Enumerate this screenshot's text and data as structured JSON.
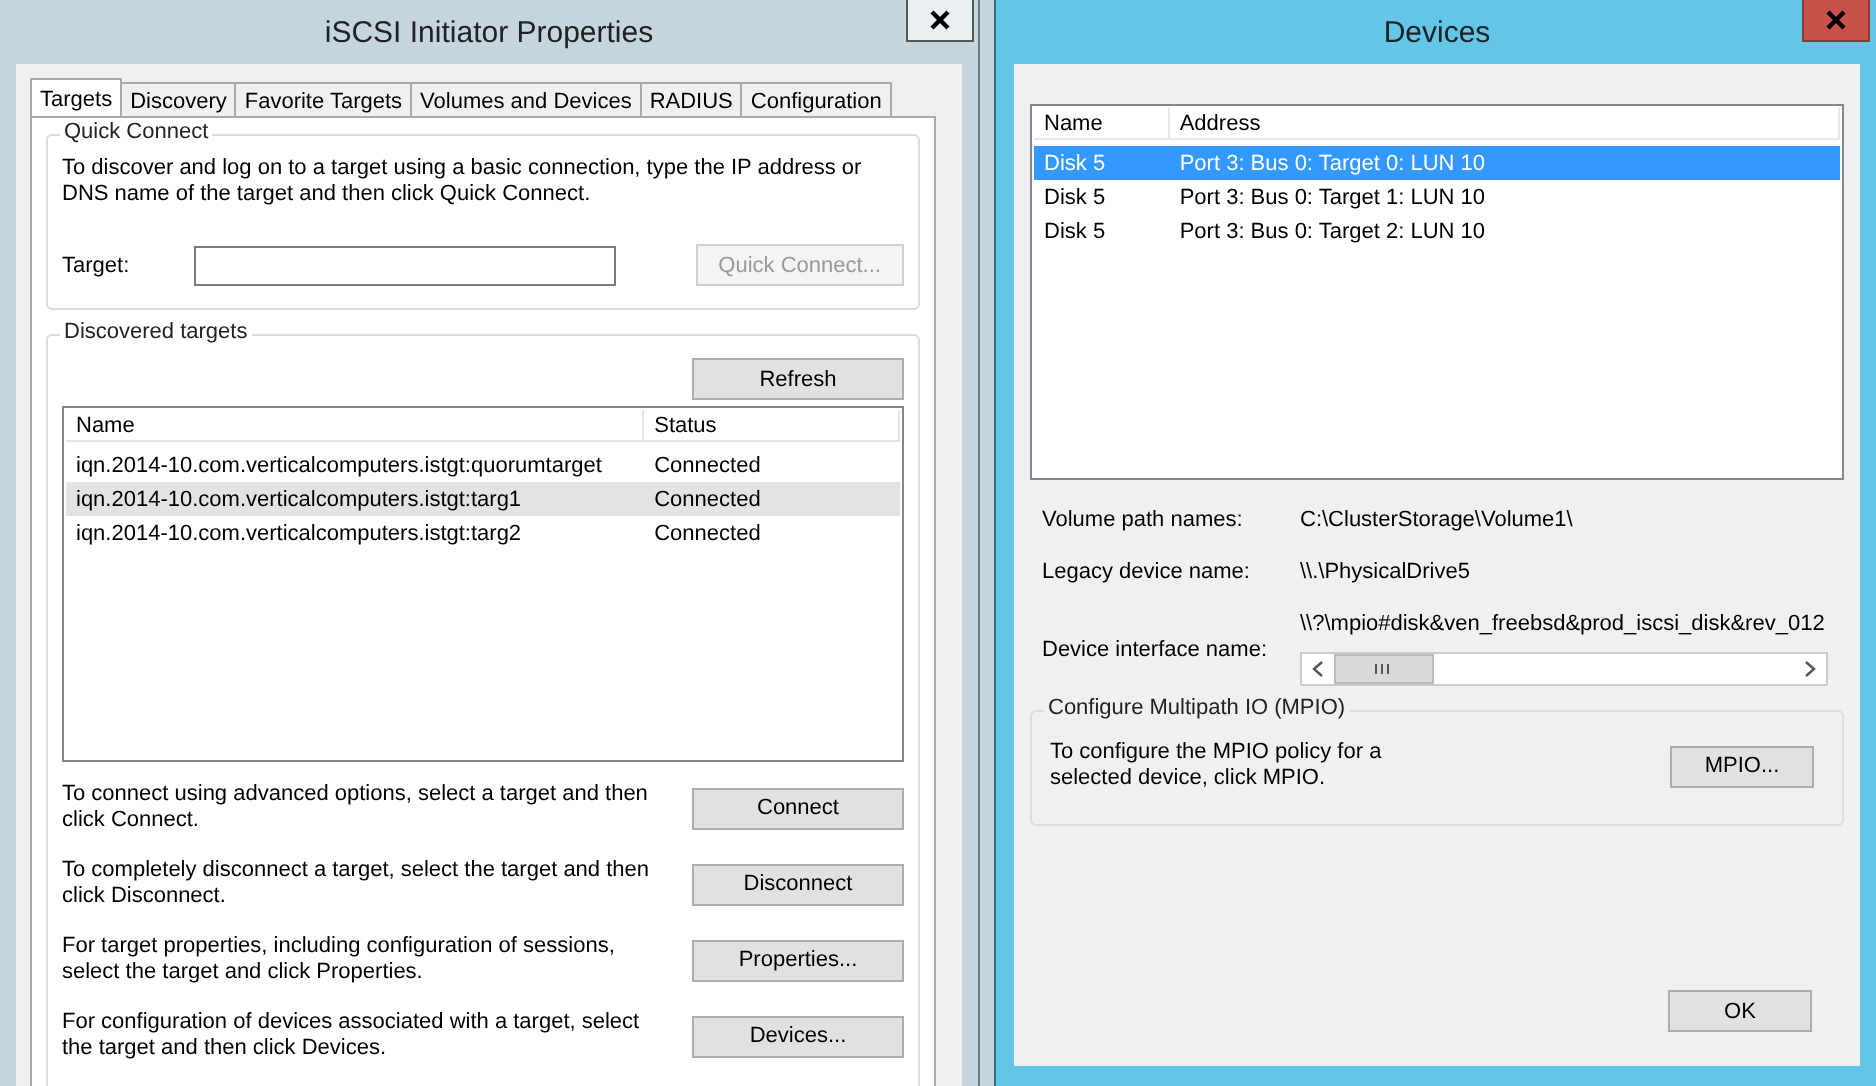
{
  "iscsi_window": {
    "title": "iSCSI Initiator Properties",
    "tabs": [
      {
        "label": "Targets",
        "selected": true
      },
      {
        "label": "Discovery",
        "selected": false
      },
      {
        "label": "Favorite Targets",
        "selected": false
      },
      {
        "label": "Volumes and Devices",
        "selected": false
      },
      {
        "label": "RADIUS",
        "selected": false
      },
      {
        "label": "Configuration",
        "selected": false
      }
    ],
    "quick_connect": {
      "legend": "Quick Connect",
      "description": "To discover and log on to a target using a basic connection, type the IP address or DNS name of the target and then click Quick Connect.",
      "target_label": "Target:",
      "button": {
        "label": "Quick Connect...",
        "disabled": true
      }
    },
    "discovered_targets": {
      "legend": "Discovered targets",
      "refresh_button": "Refresh",
      "columns": [
        "Name",
        "Status"
      ],
      "rows": [
        {
          "name": "iqn.2014-10.com.verticalcomputers.istgt:quorumtarget",
          "status": "Connected",
          "selected": false
        },
        {
          "name": "iqn.2014-10.com.verticalcomputers.istgt:targ1",
          "status": "Connected",
          "selected": true
        },
        {
          "name": "iqn.2014-10.com.verticalcomputers.istgt:targ2",
          "status": "Connected",
          "selected": false
        }
      ],
      "actions": [
        {
          "description": "To connect using advanced options, select a target and then click Connect.",
          "button": "Connect"
        },
        {
          "description": "To completely disconnect a target, select the target and then click Disconnect.",
          "button": "Disconnect"
        },
        {
          "description": "For target properties, including configuration of sessions, select the target and click Properties.",
          "button": "Properties..."
        },
        {
          "description": "For configuration of devices associated with a target, select the target and then click Devices.",
          "button": "Devices..."
        }
      ]
    }
  },
  "devices_window": {
    "title": "Devices",
    "columns": [
      "Name",
      "Address"
    ],
    "rows": [
      {
        "name": "Disk 5",
        "address": "Port 3: Bus 0: Target 0: LUN 10",
        "selected": true
      },
      {
        "name": "Disk 5",
        "address": "Port 3: Bus 0: Target 1: LUN 10",
        "selected": false
      },
      {
        "name": "Disk 5",
        "address": "Port 3: Bus 0: Target 2: LUN 10",
        "selected": false
      }
    ],
    "fields": [
      {
        "label": "Volume path names:",
        "value": "C:\\ClusterStorage\\Volume1\\",
        "kind": "plain"
      },
      {
        "label": "Legacy device name:",
        "value": "\\\\.\\PhysicalDrive5",
        "kind": "plain"
      },
      {
        "label": "Device interface name:",
        "value": "\\\\?\\mpio#disk&ven_freebsd&prod_iscsi_disk&rev_012",
        "kind": "scrolling"
      }
    ],
    "mpio": {
      "legend": "Configure Multipath IO (MPIO)",
      "description": "To configure the MPIO policy for a selected device, click MPIO.",
      "button": "MPIO..."
    },
    "ok_button": "OK"
  }
}
